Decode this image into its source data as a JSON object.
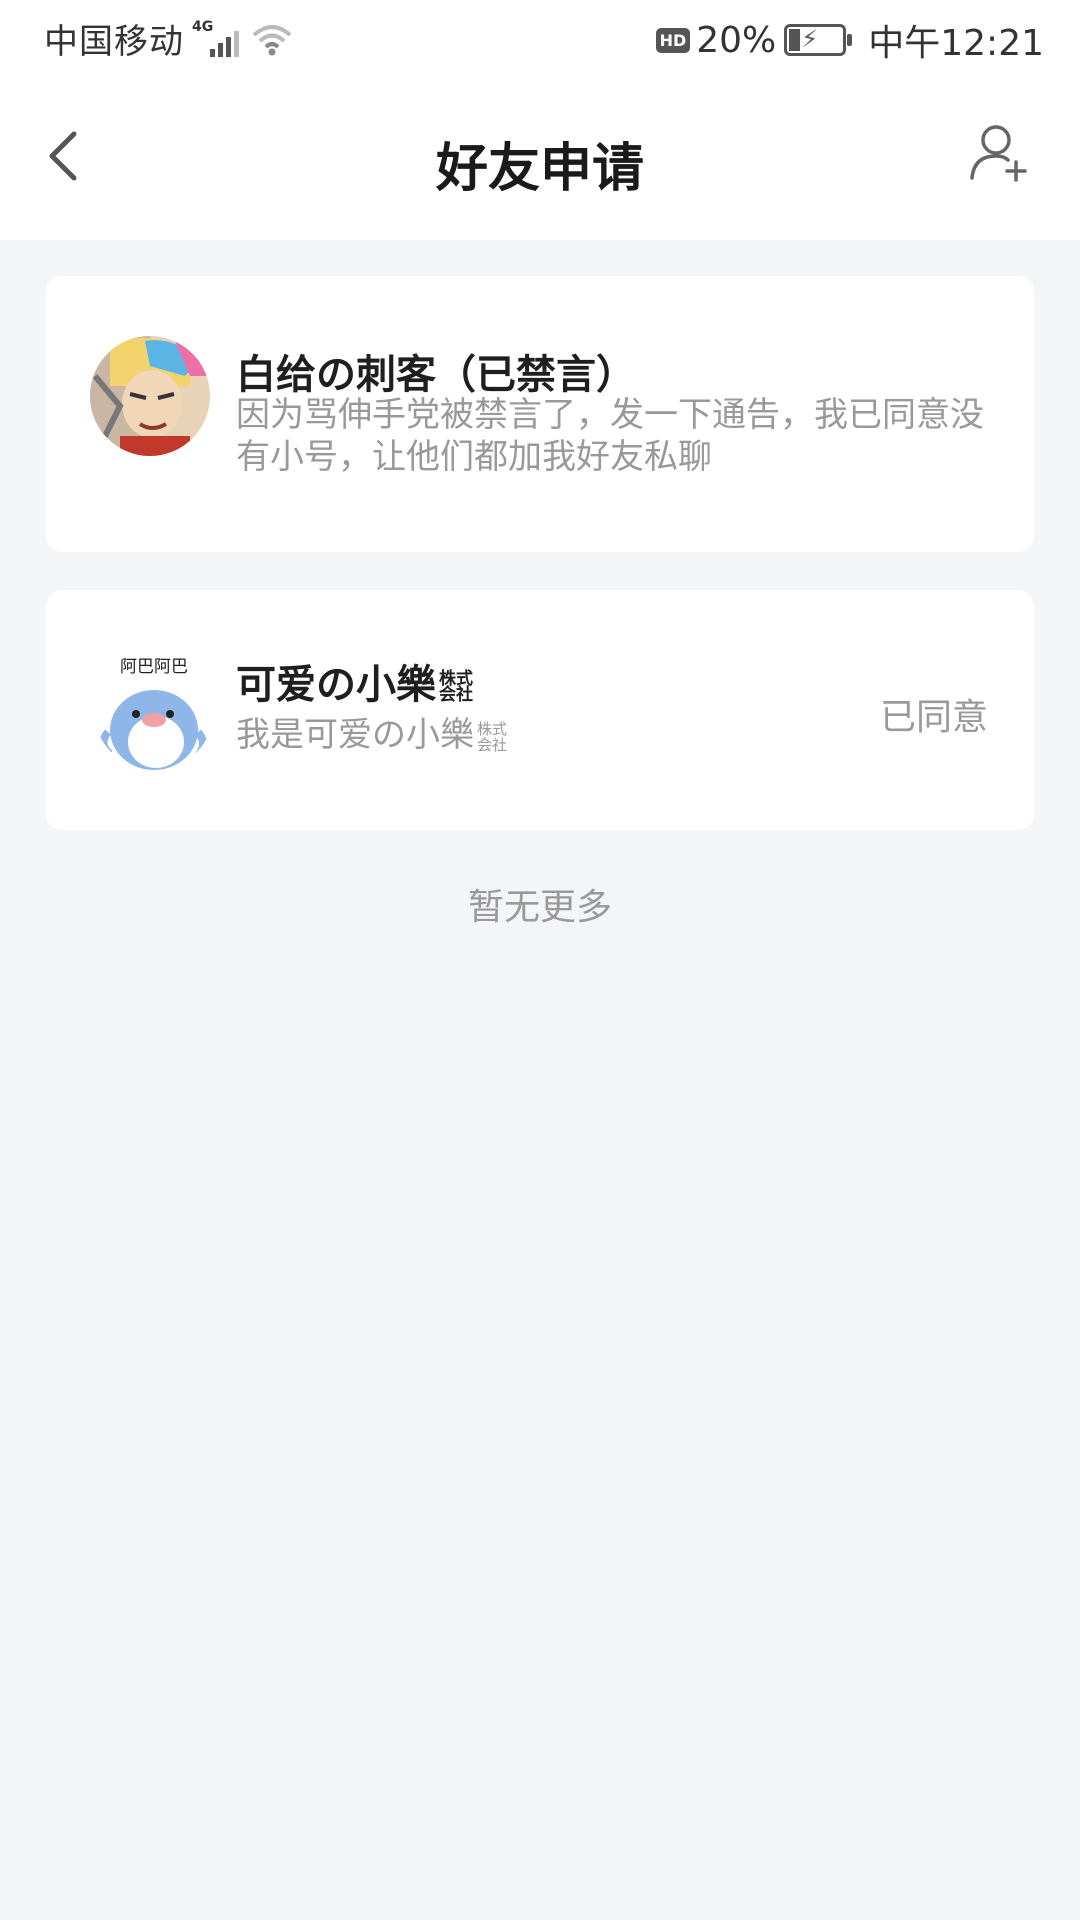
{
  "statusbar": {
    "carrier": "中国移动",
    "network": "4G",
    "hd": "HD",
    "battery": "20%",
    "time": "中午12:21"
  },
  "nav": {
    "title": "好友申请",
    "back_icon": "chevron-left-icon",
    "add_icon": "add-friend-icon"
  },
  "requests": [
    {
      "name": "白给の刺客（已禁言）",
      "message": "因为骂伸手党被禁言了，发一下通告，我已同意没有小号，让他们都加我好友私聊"
    },
    {
      "name": "可爱の小樂",
      "name_badge_top": "株式",
      "name_badge_bottom": "会社",
      "message": "我是可爱の小樂",
      "message_badge_top": "株式",
      "message_badge_bottom": "会社",
      "avatar_text": "阿巴阿巴",
      "status": "已同意"
    }
  ],
  "footer": {
    "no_more": "暂无更多"
  }
}
